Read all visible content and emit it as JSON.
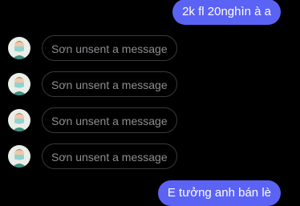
{
  "colors": {
    "background": "#000000",
    "outgoing_bubble": "#5b63f5",
    "unsent_border": "#3a3a3a",
    "unsent_text": "#8e8e93"
  },
  "messages": {
    "outgoing_top": "2k fl 20nghìn à a",
    "outgoing_bottom": "E tưởng anh bán lè"
  },
  "unsent": [
    {
      "text": "Sơn unsent a message",
      "avatar": "user-avatar-icon"
    },
    {
      "text": "Sơn unsent a message",
      "avatar": "user-avatar-icon"
    },
    {
      "text": "Sơn unsent a message",
      "avatar": "user-avatar-icon"
    },
    {
      "text": "Sơn unsent a message",
      "avatar": "user-avatar-icon"
    }
  ]
}
